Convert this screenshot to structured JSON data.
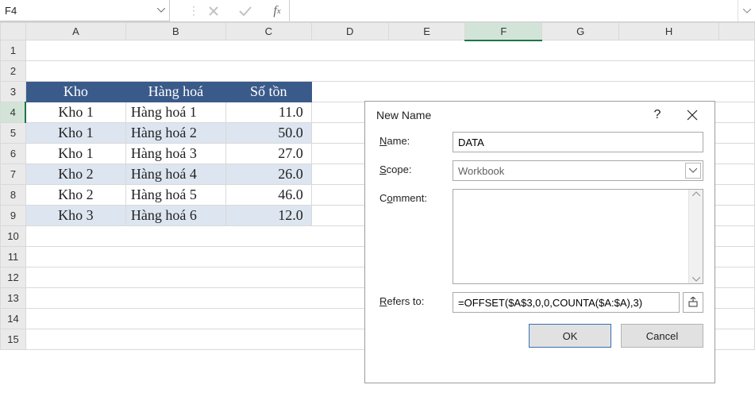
{
  "namebox": {
    "value": "F4"
  },
  "columns": [
    "A",
    "B",
    "C",
    "D",
    "E",
    "F",
    "G",
    "H"
  ],
  "selected_cell": {
    "ref": "F4",
    "col": "F",
    "row": 4
  },
  "table": {
    "headers": {
      "a": "Kho",
      "b": "Hàng hoá",
      "c": "Số tồn"
    },
    "rows": [
      {
        "a": "Kho 1",
        "b": "Hàng hoá 1",
        "c": "11.0"
      },
      {
        "a": "Kho 1",
        "b": "Hàng hoá 2",
        "c": "50.0"
      },
      {
        "a": "Kho 1",
        "b": "Hàng hoá 3",
        "c": "27.0"
      },
      {
        "a": "Kho 2",
        "b": "Hàng hoá 4",
        "c": "26.0"
      },
      {
        "a": "Kho 2",
        "b": "Hàng hoá 5",
        "c": "46.0"
      },
      {
        "a": "Kho 3",
        "b": "Hàng hoá 6",
        "c": "12.0"
      }
    ]
  },
  "dialog": {
    "title": "New Name",
    "labels": {
      "name_pre": "N",
      "name_post": "ame:",
      "scope_pre": "S",
      "scope_post": "cope:",
      "comment_pre": "C",
      "comment_mid": "o",
      "comment_post": "mment:",
      "refers_pre": "R",
      "refers_post": "efers to:"
    },
    "name_value": "DATA",
    "scope_value": "Workbook",
    "refers_value": "=OFFSET($A$3,0,0,COUNTA($A:$A),3)",
    "ok": "OK",
    "cancel": "Cancel"
  }
}
